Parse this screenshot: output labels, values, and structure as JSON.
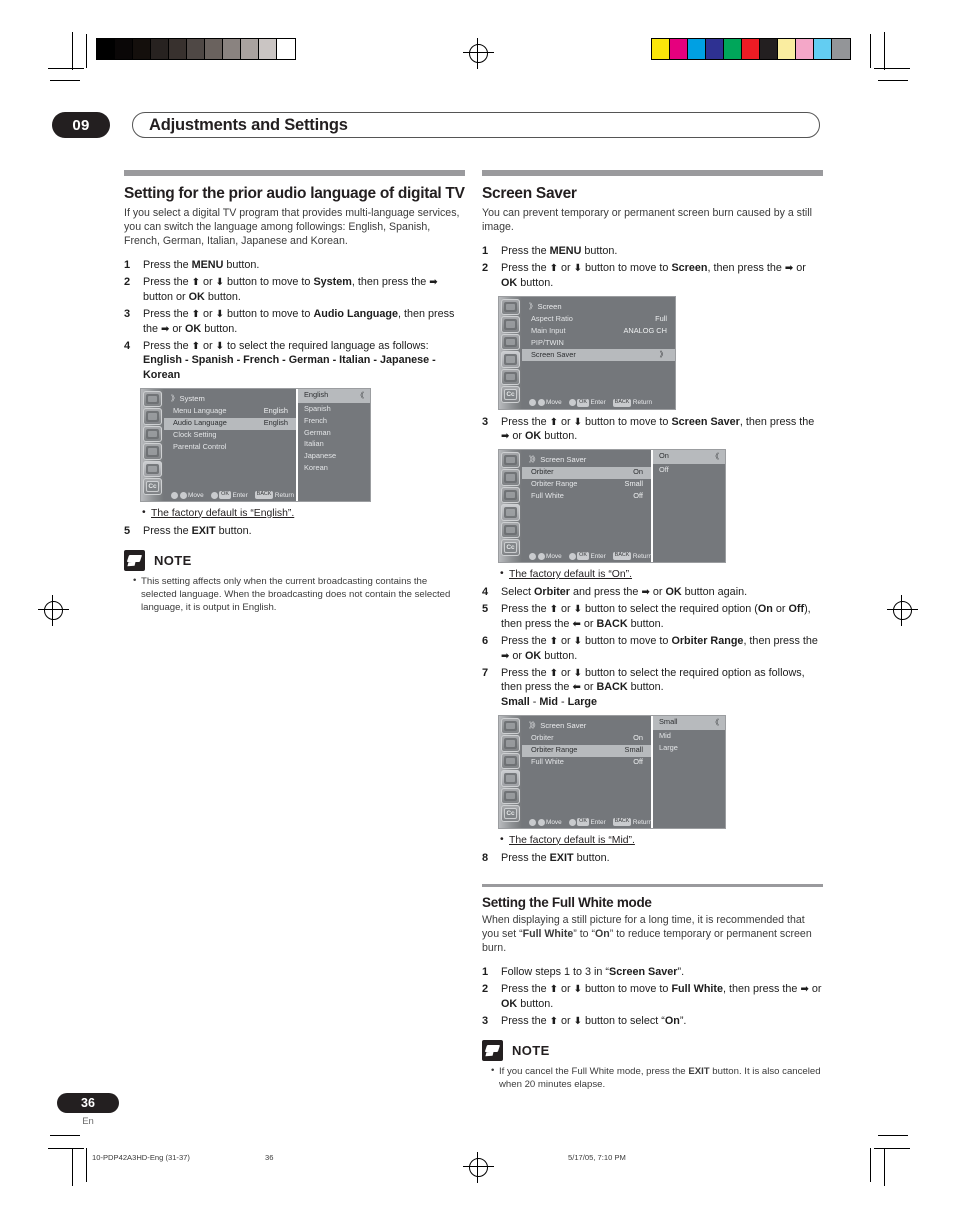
{
  "header": {
    "chapter_number": "09",
    "chapter_title": "Adjustments and Settings"
  },
  "left_column": {
    "section_title": "Setting for the prior audio language of digital TV",
    "intro": "If you select a digital TV program that provides multi-language services, you can switch the language among followings: English, Spanish, French, German, Italian, Japanese and Korean.",
    "steps": [
      {
        "n": "1",
        "html": "Press the <b>MENU</b> button."
      },
      {
        "n": "2",
        "html": "Press the <span class=\"arrow\">⬆</span> or <span class=\"arrow\">⬇</span> button to move to <b>System</b>, then press the <span class=\"arrow\">➡</span> button or <b>OK</b> button."
      },
      {
        "n": "3",
        "html": "Press the <span class=\"arrow\">⬆</span> or <span class=\"arrow\">⬇</span> button to move to <b>Audio Language</b>, then press the <span class=\"arrow\">➡</span> or <b>OK</b> button."
      },
      {
        "n": "4",
        "html": "Press the <span class=\"arrow\">⬆</span> or <span class=\"arrow\">⬇</span> to select the required language as follows:<br><b>English - Spanish - French - German - Italian - Japanese - Korean</b>"
      }
    ],
    "osd": {
      "title": "System",
      "title_chevrons": "》",
      "rows": [
        {
          "label": "Menu Language",
          "value": "English",
          "highlight": false
        },
        {
          "label": "Audio Language",
          "value": "English",
          "highlight": true
        },
        {
          "label": "Clock Setting",
          "value": "",
          "highlight": false
        },
        {
          "label": "Parental Control",
          "value": "",
          "highlight": false
        }
      ],
      "submenu": [
        {
          "label": "English",
          "selected": true
        },
        {
          "label": "Spanish",
          "selected": false
        },
        {
          "label": "French",
          "selected": false
        },
        {
          "label": "German",
          "selected": false
        },
        {
          "label": "Italian",
          "selected": false
        },
        {
          "label": "Japanese",
          "selected": false
        },
        {
          "label": "Korean",
          "selected": false
        }
      ],
      "footer": {
        "move": "Move",
        "enter": "Enter",
        "enter_key": "OK",
        "return": "Return",
        "return_key": "BACK"
      }
    },
    "default_note": "The factory default is “English”.",
    "step5": {
      "n": "5",
      "html": "Press the <b>EXIT</b> button."
    },
    "note": {
      "title": "NOTE",
      "items": [
        "This setting affects only when the current broadcasting contains the selected language. When the broadcasting does not contain the selected language, it is output in English."
      ]
    }
  },
  "right_column": {
    "section_title": "Screen Saver",
    "intro": "You can prevent temporary or permanent screen burn caused by a still image.",
    "steps_1_2": [
      {
        "n": "1",
        "html": "Press the <b>MENU</b> button."
      },
      {
        "n": "2",
        "html": "Press the <span class=\"arrow\">⬆</span> or <span class=\"arrow\">⬇</span> button to move to <b>Screen</b>, then press the <span class=\"arrow\">➡</span> or <b>OK</b> button."
      }
    ],
    "osd_screen": {
      "title": "Screen",
      "title_chevrons": "》",
      "rows": [
        {
          "label": "Aspect Ratio",
          "value": "Full",
          "highlight": false
        },
        {
          "label": "Main Input",
          "value": "ANALOG CH",
          "highlight": false
        },
        {
          "label": "PIP/TWIN",
          "value": "",
          "highlight": false
        },
        {
          "label": "Screen Saver",
          "value": "》",
          "highlight": true
        }
      ],
      "footer": {
        "move": "Move",
        "enter": "Enter",
        "enter_key": "OK",
        "return": "Return",
        "return_key": "BACK"
      }
    },
    "step3": {
      "n": "3",
      "html": "Press the <span class=\"arrow\">⬆</span> or <span class=\"arrow\">⬇</span> button to move to <b>Screen Saver</b>, then press the <span class=\"arrow\">➡</span> or <b>OK</b> button."
    },
    "osd_saver_orbiter": {
      "title": "Screen Saver",
      "title_chevrons": "》》",
      "rows": [
        {
          "label": "Orbiter",
          "value": "On",
          "highlight": true
        },
        {
          "label": "Orbiter Range",
          "value": "Small",
          "highlight": false
        },
        {
          "label": "Full White",
          "value": "Off",
          "highlight": false
        }
      ],
      "submenu": [
        {
          "label": "On",
          "selected": true
        },
        {
          "label": "Off",
          "selected": false
        }
      ],
      "footer": {
        "move": "Move",
        "enter": "Enter",
        "enter_key": "OK",
        "return": "Return",
        "return_key": "BACK"
      }
    },
    "default_note_on": "The factory default is “On”.",
    "steps_4_7": [
      {
        "n": "4",
        "html": "Select <b>Orbiter</b> and press the <span class=\"arrow\">➡</span> or <b>OK</b> button again."
      },
      {
        "n": "5",
        "html": "Press the <span class=\"arrow\">⬆</span> or <span class=\"arrow\">⬇</span> button to select the required option (<b>On</b> or <b>Off</b>), then press the <span class=\"arrow\">⬅</span> or <b>BACK</b> button."
      },
      {
        "n": "6",
        "html": "Press the <span class=\"arrow\">⬆</span> or <span class=\"arrow\">⬇</span> button to move to <b>Orbiter Range</b>, then press the <span class=\"arrow\">➡</span> or <b>OK</b> button."
      },
      {
        "n": "7",
        "html": "Press the <span class=\"arrow\">⬆</span> or <span class=\"arrow\">⬇</span> button to select the required option as follows, then press the <span class=\"arrow\">⬅</span> or <b>BACK</b> button.<br><b>Small</b> - <b>Mid</b> - <b>Large</b>"
      }
    ],
    "osd_saver_range": {
      "title": "Screen Saver",
      "title_chevrons": "》》",
      "rows": [
        {
          "label": "Orbiter",
          "value": "On",
          "highlight": false
        },
        {
          "label": "Orbiter Range",
          "value": "Small",
          "highlight": true
        },
        {
          "label": "Full White",
          "value": "Off",
          "highlight": false
        }
      ],
      "submenu": [
        {
          "label": "Small",
          "selected": true
        },
        {
          "label": "Mid",
          "selected": false
        },
        {
          "label": "Large",
          "selected": false
        }
      ],
      "footer": {
        "move": "Move",
        "enter": "Enter",
        "enter_key": "OK",
        "return": "Return",
        "return_key": "BACK"
      }
    },
    "default_note_mid": "The factory default is “Mid”.",
    "step8": {
      "n": "8",
      "html": "Press the <b>EXIT</b> button."
    },
    "fullwhite": {
      "section_title": "Setting the Full White mode",
      "intro_html": "When displaying a still picture for a long time, it is recommended that you set “<b>Full White</b>” to “<b>On</b>” to reduce temporary or permanent screen burn.",
      "steps": [
        {
          "n": "1",
          "html": "Follow steps 1 to 3 in “<b>Screen Saver</b>”."
        },
        {
          "n": "2",
          "html": "Press the <span class=\"arrow\">⬆</span> or <span class=\"arrow\">⬇</span> button to move to <b>Full White</b>, then press the <span class=\"arrow\">➡</span> or <b>OK</b> button."
        },
        {
          "n": "3",
          "html": "Press the <span class=\"arrow\">⬆</span> or <span class=\"arrow\">⬇</span> button to select “<b>On</b>”."
        }
      ],
      "note": {
        "title": "NOTE",
        "items": [
          "If you cancel the Full White mode, press the <b>EXIT</b> button. It is also canceled when 20 minutes elapse."
        ]
      }
    }
  },
  "footer": {
    "page_number": "36",
    "language_code": "En",
    "imprint_left": "10-PDP42A3HD-Eng (31-37)",
    "imprint_mid": "36",
    "imprint_right": "5/17/05, 7:10 PM"
  },
  "print_marks": {
    "gray_bars": [
      "#000000",
      "#0a0707",
      "#140f0c",
      "#272220",
      "#38312e",
      "#4f4845",
      "#6a625e",
      "#8a8380",
      "#a9a29f",
      "#cac5c3",
      "#ffffff"
    ],
    "color_bars": [
      "#fbe60a",
      "#e6007e",
      "#00a0e3",
      "#2e3192",
      "#00a65a",
      "#ed1c24",
      "#231f20",
      "#faeda0",
      "#f4a7c8",
      "#63cdf2",
      "#939598"
    ]
  }
}
